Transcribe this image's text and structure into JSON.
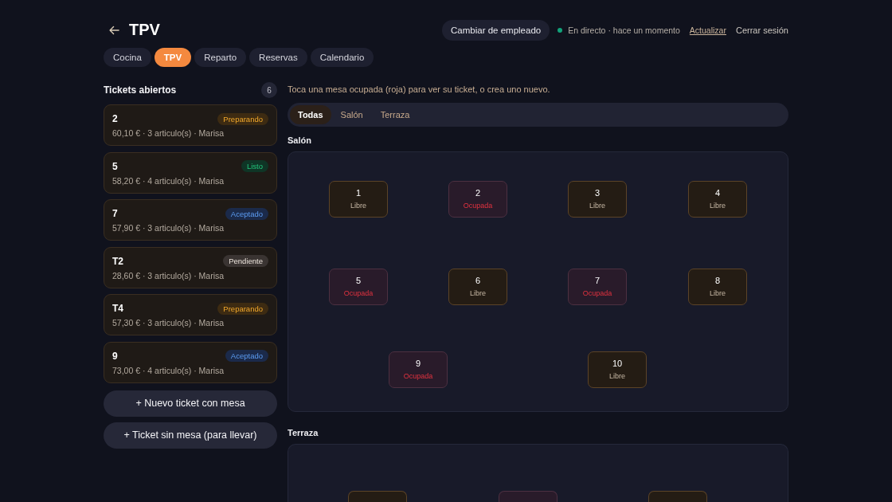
{
  "header": {
    "title": "TPV",
    "employee_button": "Cambiar de empleado",
    "live_status": "En directo · hace un momento",
    "refresh": "Actualizar",
    "logout": "Cerrar sesión"
  },
  "nav_tabs": [
    {
      "label": "Cocina",
      "selected": false
    },
    {
      "label": "TPV",
      "selected": true
    },
    {
      "label": "Reparto",
      "selected": false
    },
    {
      "label": "Reservas",
      "selected": false
    },
    {
      "label": "Calendario",
      "selected": false
    }
  ],
  "tickets": {
    "title": "Tickets abiertos",
    "count": "6",
    "items": [
      {
        "number": "2",
        "status": {
          "label": "Preparando",
          "kind": "preparing"
        },
        "summary": "60,10 € · 3 articulo(s) · Marisa"
      },
      {
        "number": "5",
        "status": {
          "label": "Listo",
          "kind": "ready"
        },
        "summary": "58,20 € · 4 articulo(s) · Marisa"
      },
      {
        "number": "7",
        "status": {
          "label": "Aceptado",
          "kind": "accepted"
        },
        "summary": "57,90 € · 3 articulo(s) · Marisa"
      },
      {
        "number": "T2",
        "status": {
          "label": "Pendiente",
          "kind": "pending"
        },
        "summary": "28,60 € · 3 articulo(s) · Marisa"
      },
      {
        "number": "T4",
        "status": {
          "label": "Preparando",
          "kind": "preparing"
        },
        "summary": "57,30 € · 3 articulo(s) · Marisa"
      },
      {
        "number": "9",
        "status": {
          "label": "Aceptado",
          "kind": "accepted"
        },
        "summary": "73,00 € · 4 articulo(s) · Marisa"
      }
    ]
  },
  "actions": [
    {
      "label": "+ Nuevo ticket con mesa"
    },
    {
      "label": "+ Ticket sin mesa (para llevar)"
    }
  ],
  "floor": {
    "hint": "Toca una mesa ocupada (roja) para ver su ticket, o crea uno nuevo.",
    "filters": [
      {
        "label": "Todas",
        "selected": true
      },
      {
        "label": "Salón",
        "selected": false
      },
      {
        "label": "Terraza",
        "selected": false
      }
    ],
    "sections": [
      {
        "title": "Salón",
        "tables": [
          {
            "number": "1",
            "status": "Libre",
            "kind": "free"
          },
          {
            "number": "2",
            "status": "Ocupada",
            "kind": "occupied"
          },
          {
            "number": "3",
            "status": "Libre",
            "kind": "free"
          },
          {
            "number": "4",
            "status": "Libre",
            "kind": "free"
          },
          {
            "number": "5",
            "status": "Ocupada",
            "kind": "occupied"
          },
          {
            "number": "6",
            "status": "Libre",
            "kind": "free"
          },
          {
            "number": "7",
            "status": "Ocupada",
            "kind": "occupied"
          },
          {
            "number": "8",
            "status": "Libre",
            "kind": "free"
          },
          {
            "number": "9",
            "status": "Ocupada",
            "kind": "occupied"
          },
          {
            "number": "10",
            "status": "Libre",
            "kind": "free"
          }
        ]
      },
      {
        "title": "Terraza",
        "tables": [
          {
            "kind": "free"
          },
          {
            "kind": "occupied"
          },
          {
            "kind": "free"
          }
        ]
      }
    ]
  }
}
